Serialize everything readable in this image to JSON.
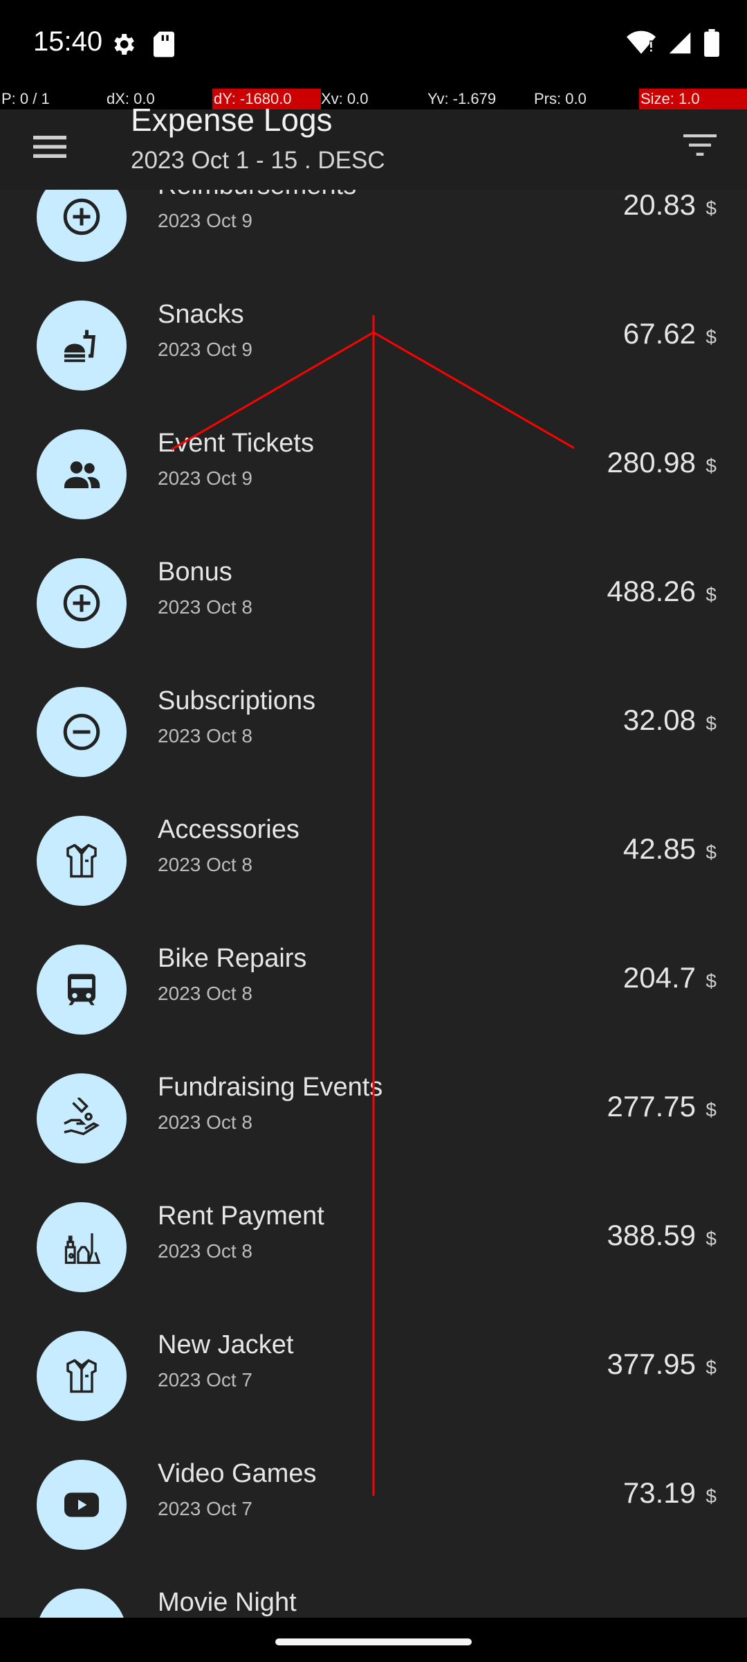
{
  "status": {
    "time": "15:40"
  },
  "debug": {
    "segments": [
      {
        "text": "P: 0 / 1",
        "bg": "#000000"
      },
      {
        "text": "dX: 0.0",
        "bg": "#000000"
      },
      {
        "text": "dY: -1680.0",
        "bg": "#cc0000"
      },
      {
        "text": "Xv: 0.0",
        "bg": "#000000"
      },
      {
        "text": "Yv: -1.679",
        "bg": "#000000"
      },
      {
        "text": "Prs: 0.0",
        "bg": "#000000"
      },
      {
        "text": "Size: 1.0",
        "bg": "#cc0000"
      }
    ]
  },
  "header": {
    "title": "Expense Logs",
    "subtitle": "2023 Oct 1 - 15 . DESC"
  },
  "colors": {
    "avatar_bg": "#c7ecff",
    "list_bg": "#222222",
    "appbar_bg": "#1f1f1f",
    "debug_line": "#ff0000"
  },
  "items": [
    {
      "title": "Reimbursements",
      "date": "2023 Oct 9",
      "amount": "20.83",
      "currency": "$",
      "icon": "plus-circle-icon"
    },
    {
      "title": "Snacks",
      "date": "2023 Oct 9",
      "amount": "67.62",
      "currency": "$",
      "icon": "fastfood-icon"
    },
    {
      "title": "Event Tickets",
      "date": "2023 Oct 9",
      "amount": "280.98",
      "currency": "$",
      "icon": "people-icon"
    },
    {
      "title": "Bonus",
      "date": "2023 Oct 8",
      "amount": "488.26",
      "currency": "$",
      "icon": "plus-circle-icon"
    },
    {
      "title": "Subscriptions",
      "date": "2023 Oct 8",
      "amount": "32.08",
      "currency": "$",
      "icon": "minus-circle-icon"
    },
    {
      "title": "Accessories",
      "date": "2023 Oct 8",
      "amount": "42.85",
      "currency": "$",
      "icon": "shirt-icon"
    },
    {
      "title": "Bike Repairs",
      "date": "2023 Oct 8",
      "amount": "204.7",
      "currency": "$",
      "icon": "train-icon"
    },
    {
      "title": "Fundraising Events",
      "date": "2023 Oct 8",
      "amount": "277.75",
      "currency": "$",
      "icon": "donation-icon"
    },
    {
      "title": "Rent Payment",
      "date": "2023 Oct 8",
      "amount": "388.59",
      "currency": "$",
      "icon": "cleaning-icon"
    },
    {
      "title": "New Jacket",
      "date": "2023 Oct 7",
      "amount": "377.95",
      "currency": "$",
      "icon": "shirt-icon"
    },
    {
      "title": "Video Games",
      "date": "2023 Oct 7",
      "amount": "73.19",
      "currency": "$",
      "icon": "youtube-icon"
    },
    {
      "title": "Movie Night",
      "date": "",
      "amount": "",
      "currency": "",
      "icon": "avatar-icon"
    }
  ]
}
